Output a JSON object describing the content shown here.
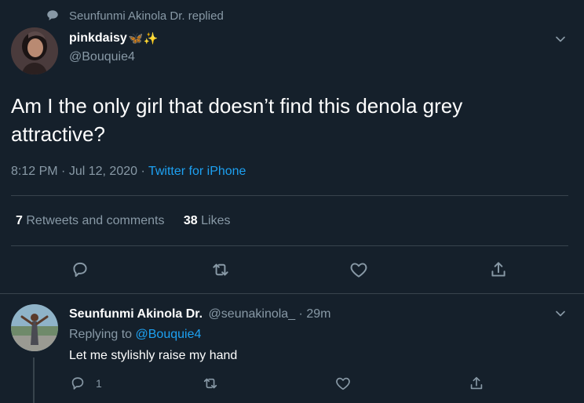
{
  "context": {
    "replied_text": "Seunfunmi Akinola Dr. replied"
  },
  "main_tweet": {
    "display_name": "pinkdaisy",
    "name_emojis": "🦋✨",
    "handle": "@Bouquie4",
    "text": "Am I the only girl that doesn’t find this denola grey attractive?",
    "time": "8:12 PM",
    "date": "Jul 12, 2020",
    "separator": "·",
    "source": "Twitter for iPhone",
    "stats": {
      "retweets_count": "7",
      "retweets_label": "Retweets and comments",
      "likes_count": "38",
      "likes_label": "Likes"
    }
  },
  "reply": {
    "display_name": "Seunfunmi Akinola Dr.",
    "handle": "@seunakinola_",
    "separator": "·",
    "time_ago": "29m",
    "replying_prefix": "Replying to",
    "replying_handle": "@Bouquie4",
    "text": "Let me stylishly raise my hand",
    "reply_count": "1"
  },
  "colors": {
    "background": "#15202b",
    "accent": "#1da1f2",
    "muted": "#8899a6",
    "divider": "#38444d"
  },
  "icons": [
    "chat-bubble-icon",
    "chevron-down-icon",
    "reply-icon",
    "retweet-icon",
    "like-icon",
    "share-icon"
  ]
}
